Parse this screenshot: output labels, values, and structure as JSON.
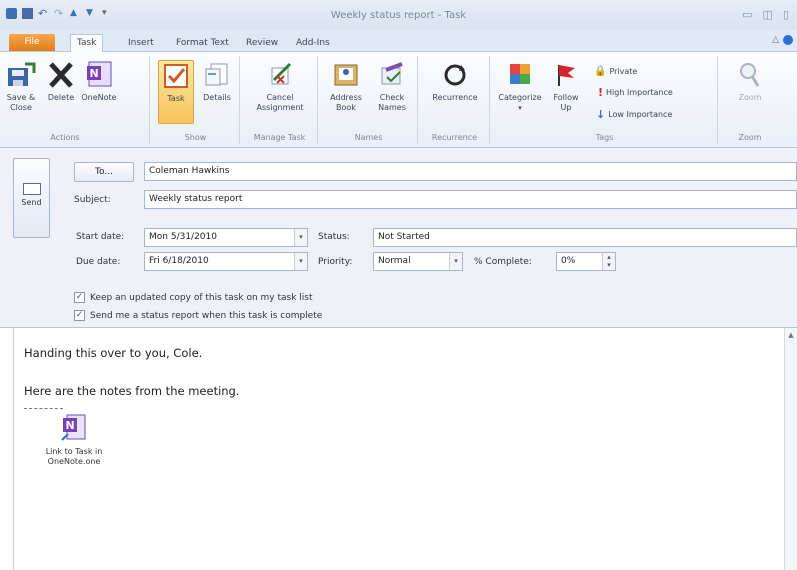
{
  "window": {
    "title": "Weekly status report - Task"
  },
  "tabs": [
    {
      "label": "File"
    },
    {
      "label": "Task"
    },
    {
      "label": "Insert"
    },
    {
      "label": "Format Text"
    },
    {
      "label": "Review"
    },
    {
      "label": "Add-Ins"
    }
  ],
  "ribbon": {
    "actions": {
      "label": "Actions",
      "save_close": "Save &\nClose",
      "delete": "Delete",
      "onenote": "OneNote"
    },
    "show": {
      "label": "Show",
      "task": "Task",
      "details": "Details"
    },
    "manage_task": {
      "label": "Manage Task",
      "cancel_assignment": "Cancel\nAssignment"
    },
    "names": {
      "label": "Names",
      "address_book": "Address\nBook",
      "check_names": "Check\nNames"
    },
    "recurrence": {
      "label": "Recurrence",
      "recurrence": "Recurrence"
    },
    "tags": {
      "label": "Tags",
      "categorize": "Categorize",
      "follow_up": "Follow\nUp",
      "private": "Private",
      "high_importance": "High Importance",
      "low_importance": "Low Importance"
    },
    "zoom": {
      "label": "Zoom",
      "zoom": "Zoom"
    }
  },
  "form": {
    "send": "Send",
    "to_button": "To...",
    "to_value": "Coleman Hawkins",
    "subject_label": "Subject:",
    "subject_value": "Weekly status report",
    "start_date_label": "Start date:",
    "start_date_value": "Mon 5/31/2010",
    "due_date_label": "Due date:",
    "due_date_value": "Fri 6/18/2010",
    "status_label": "Status:",
    "status_value": "Not Started",
    "priority_label": "Priority:",
    "priority_value": "Normal",
    "percent_label": "% Complete:",
    "percent_value": "0%",
    "keep_copy": "Keep an updated copy of this task on my task list",
    "send_report": "Send me a status report when this task is complete"
  },
  "body": {
    "line1": "Handing this over to you, Cole.",
    "line2": "Here are the notes from the meeting.",
    "attachment": "Link to Task in\nOneNote.one"
  }
}
